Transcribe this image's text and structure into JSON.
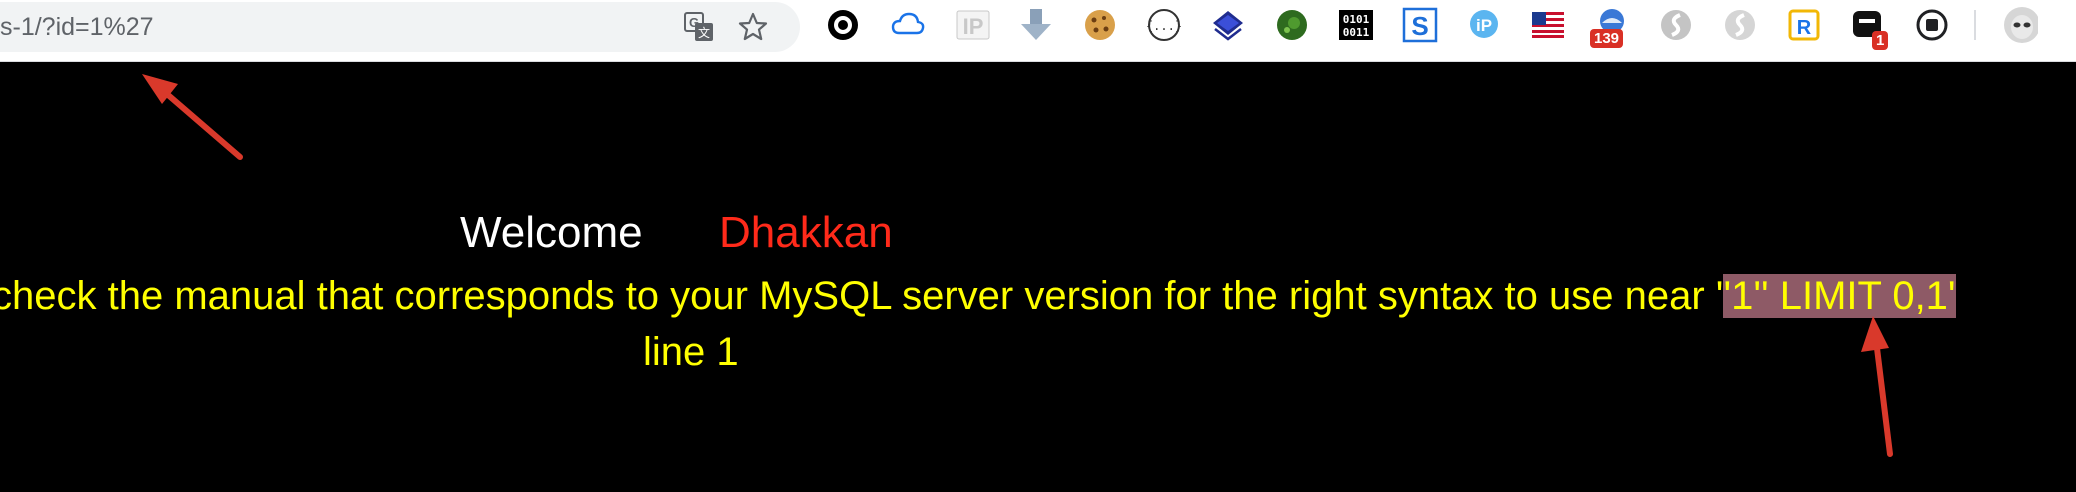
{
  "browser": {
    "url": "s-1/?id=1%27",
    "extensions": [
      {
        "icon": "circle-record-icon"
      },
      {
        "icon": "cloud-icon"
      },
      {
        "icon": "ip-icon",
        "text": "IP"
      },
      {
        "icon": "download-arrow-icon"
      },
      {
        "icon": "cookie-icon"
      },
      {
        "icon": "json-braces-icon",
        "text": "{...}"
      },
      {
        "icon": "layers-icon"
      },
      {
        "icon": "globe-green-icon"
      },
      {
        "icon": "binary-icon",
        "text": "0101 0011"
      },
      {
        "icon": "s-square-icon",
        "text": "S"
      },
      {
        "icon": "ip-bubble-icon",
        "text": "iP"
      },
      {
        "icon": "us-flag-icon"
      },
      {
        "icon": "weather-badge-icon",
        "badge": "139"
      },
      {
        "icon": "grey-s-icon"
      },
      {
        "icon": "grey-s-icon-2"
      },
      {
        "icon": "r-icon",
        "text": "R"
      },
      {
        "icon": "terminal-badge-icon",
        "badge": "1"
      },
      {
        "icon": "stop-icon"
      },
      {
        "icon": "profile-avatar-icon"
      }
    ],
    "colors": {
      "badge": "#d93025",
      "toolbar": "#ffffff",
      "omnibox": "#f1f3f4"
    }
  },
  "page": {
    "welcome": "Welcome",
    "name": "Dhakkan",
    "error_prefix": "check the manual that corresponds to your MySQL server version for the right syntax to use near '",
    "error_highlight": "'1'' LIMIT 0,1'",
    "error_line2": "line 1",
    "colors": {
      "background": "#000000",
      "welcome": "#ffffff",
      "name": "#ff2a1a",
      "error": "#ffff00",
      "highlight": "#8e5a66",
      "annotation": "#d9392b"
    }
  }
}
